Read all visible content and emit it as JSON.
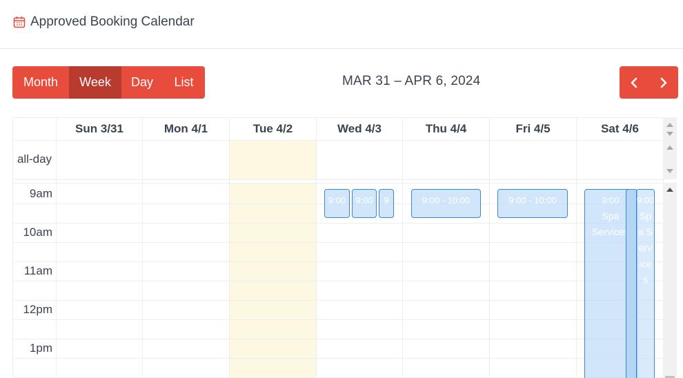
{
  "header": {
    "title": "Approved Booking Calendar",
    "icon": "calendar-icon",
    "icon_color": "#e74c3c"
  },
  "toolbar": {
    "views": [
      {
        "label": "Month",
        "active": false
      },
      {
        "label": "Week",
        "active": true
      },
      {
        "label": "Day",
        "active": false
      },
      {
        "label": "List",
        "active": false
      }
    ],
    "range_title": "MAR 31 – APR 6, 2024",
    "prev_icon": "chevron-left-icon",
    "next_icon": "chevron-right-icon",
    "accent_color": "#e74c3c",
    "active_color": "#b93a2f"
  },
  "calendar": {
    "days": [
      "Sun 3/31",
      "Mon 4/1",
      "Tue 4/2",
      "Wed 4/3",
      "Thu 4/4",
      "Fri 4/5",
      "Sat 4/6"
    ],
    "today_index": 2,
    "today_color": "#fdf8e1",
    "allday_label": "all-day",
    "time_slots": [
      "9am",
      "10am",
      "11am",
      "12pm",
      "1pm"
    ],
    "events": [
      {
        "day": "Wed 4/3",
        "time": "9:00",
        "title": "",
        "start": "9:00",
        "end": "10:00"
      },
      {
        "day": "Wed 4/3",
        "time": "9:00",
        "title": "",
        "start": "9:00",
        "end": "10:00"
      },
      {
        "day": "Wed 4/3",
        "time": "9",
        "title": "",
        "start": "9:00",
        "end": "10:00"
      },
      {
        "day": "Thu 4/4",
        "time": "9:00 - 10:00",
        "title": "",
        "start": "9:00",
        "end": "10:00"
      },
      {
        "day": "Fri 4/5",
        "time": "9:00 - 10:00",
        "title": "",
        "start": "9:00",
        "end": "10:00"
      },
      {
        "day": "Sat 4/6",
        "time": "9:00",
        "title": "Spa Services",
        "start": "9:00",
        "end": "later"
      },
      {
        "day": "Sat 4/6",
        "time": "",
        "title": "",
        "start": "9:00",
        "end": "later"
      },
      {
        "day": "Sat 4/6",
        "time": "9:00",
        "title": "Spa Services",
        "start": "9:00",
        "end": "later"
      }
    ],
    "event_color": "#3a87d0"
  }
}
